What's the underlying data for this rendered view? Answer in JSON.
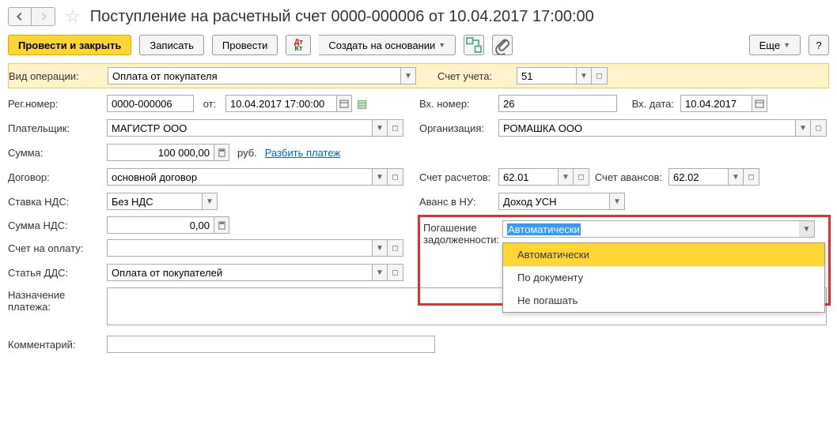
{
  "title": "Поступление на расчетный счет 0000-000006 от 10.04.2017 17:00:00",
  "toolbar": {
    "post_close": "Провести и закрыть",
    "record": "Записать",
    "post": "Провести",
    "create_based": "Создать на основании",
    "more": "Еще"
  },
  "labels": {
    "op_type": "Вид операции:",
    "account": "Счет учета:",
    "reg_no": "Рег.номер:",
    "from": "от:",
    "in_no": "Вх. номер:",
    "in_date": "Вх. дата:",
    "payer": "Плательщик:",
    "org": "Организация:",
    "amount": "Сумма:",
    "rub": "руб.",
    "split": "Разбить платеж",
    "contract": "Договор:",
    "settle_acc": "Счет расчетов:",
    "advance_acc": "Счет авансов:",
    "vat_rate": "Ставка НДС:",
    "advance_nu": "Аванс в НУ:",
    "vat_amount": "Сумма НДС:",
    "debt_repay": "Погашение задолженности:",
    "invoice": "Счет на оплату:",
    "dds": "Статья ДДС:",
    "purpose": "Назначение платежа:",
    "comment": "Комментарий:"
  },
  "values": {
    "op_type": "Оплата от покупателя",
    "account": "51",
    "reg_no": "0000-000006",
    "date": "10.04.2017 17:00:00",
    "in_no": "26",
    "in_date": "10.04.2017",
    "payer": "МАГИСТР ООО",
    "org": "РОМАШКА ООО",
    "amount": "100 000,00",
    "contract": "основной договор",
    "settle_acc": "62.01",
    "advance_acc": "62.02",
    "vat_rate": "Без НДС",
    "advance_nu": "Доход УСН",
    "vat_amount": "0,00",
    "debt_repay": "Автоматически",
    "dds": "Оплата от покупателей",
    "purpose": "",
    "comment": ""
  },
  "dropdown": {
    "opt1": "Автоматически",
    "opt2": "По документу",
    "opt3": "Не погашать"
  }
}
